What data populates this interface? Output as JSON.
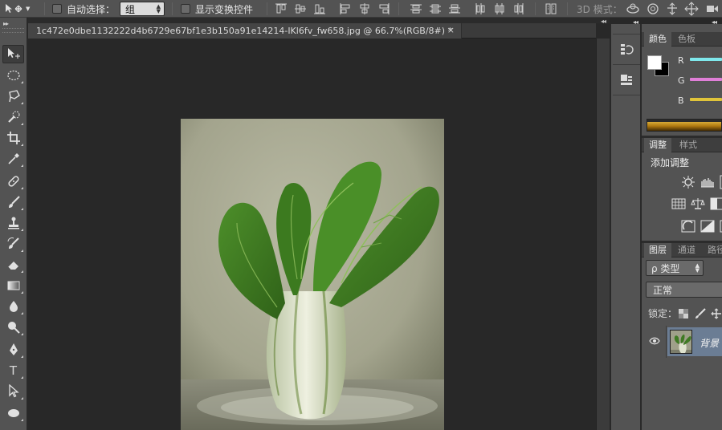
{
  "options_bar": {
    "auto_select_label": "自动选择：",
    "auto_select_value": "组",
    "show_transform_label": "显示变换控件",
    "mode_3d_label": "3D 模式："
  },
  "document": {
    "tab_title": "1c472e0dbe1132222d4b6729e67bf1e3b150a91e14214-IKl6fv_fw658.jpg @ 66.7%(RGB/8#) *",
    "close_glyph": "×"
  },
  "toolbar": {
    "active_tool": "move-tool",
    "tools": [
      "move-tool",
      "marquee-tool",
      "lasso-tool",
      "quick-selection-tool",
      "crop-tool",
      "eyedropper-tool",
      "healing-brush-tool",
      "brush-tool",
      "clone-stamp-tool",
      "history-brush-tool",
      "eraser-tool",
      "gradient-tool",
      "blur-tool",
      "dodge-tool",
      "pen-tool",
      "type-tool",
      "path-selection-tool",
      "shape-tool"
    ],
    "type_tool_glyph": "T"
  },
  "color_panel": {
    "tabs": [
      "颜色",
      "色板"
    ],
    "active_tab": "颜色",
    "foreground": "#ffffff",
    "background": "#000000",
    "channels": [
      {
        "label": "R",
        "color": "#7fe8ec"
      },
      {
        "label": "G",
        "color": "#e07fd8"
      },
      {
        "label": "B",
        "color": "#e0c43a"
      }
    ]
  },
  "adjustments_panel": {
    "tabs": [
      "调整",
      "样式"
    ],
    "active_tab": "调整",
    "title": "添加调整"
  },
  "layers_panel": {
    "tabs": [
      "图层",
      "通道",
      "路径"
    ],
    "active_tab": "图层",
    "filter_label": "ρ 类型",
    "blend_mode": "正常",
    "lock_label": "锁定：",
    "layers": [
      {
        "name": "背景",
        "visible": true,
        "selected": true
      }
    ]
  },
  "colors": {
    "ui_dark": "#282828",
    "ui_panel": "#535353",
    "layer_selected": "#6b7d94",
    "photo_background": "#a2a38e",
    "leaf_green": "#3f7a24",
    "stem_white": "#dfe3cf"
  }
}
